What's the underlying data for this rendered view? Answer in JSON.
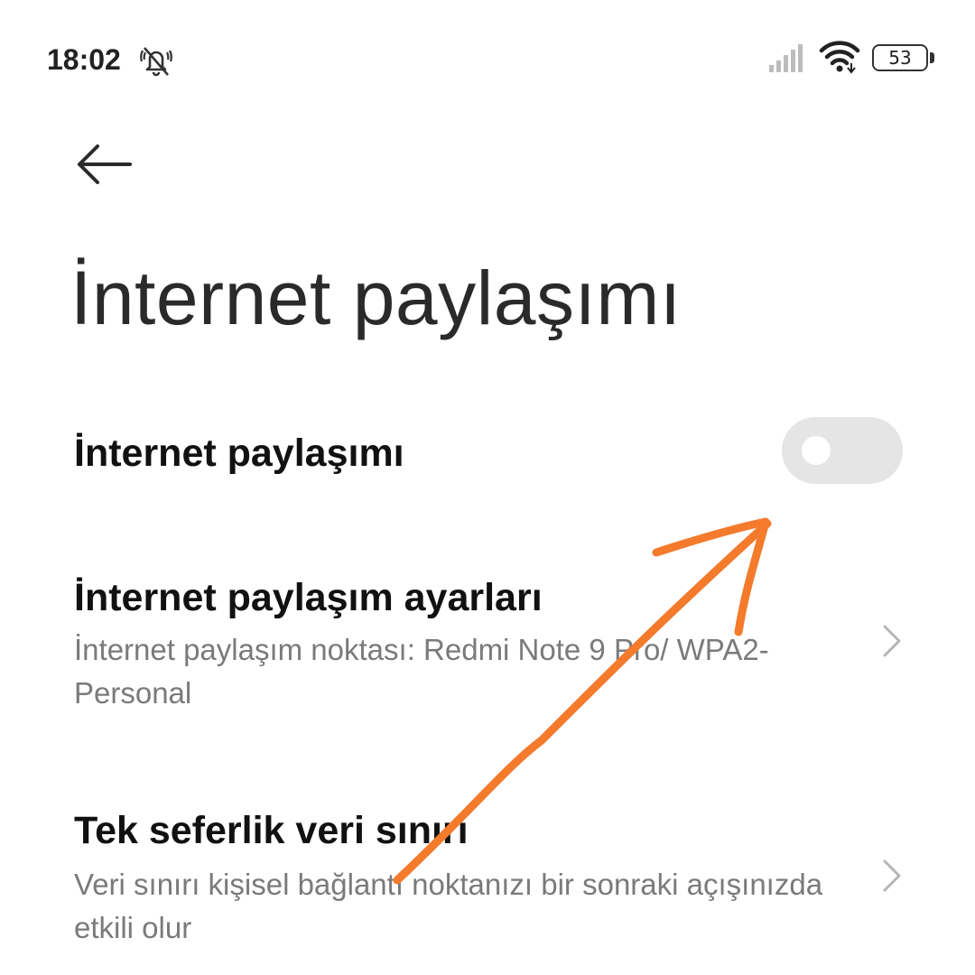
{
  "status_bar": {
    "time": "18:02",
    "battery_level": "53",
    "icons": [
      "dnd-muted-bell-icon",
      "signal-icon",
      "wifi-icon",
      "battery-icon"
    ]
  },
  "header": {
    "back_icon": "arrow-left-icon",
    "title": "İnternet paylaşımı"
  },
  "settings": {
    "items": [
      {
        "title": "İnternet paylaşımı",
        "control": "toggle",
        "enabled": false
      },
      {
        "title": "İnternet paylaşım ayarları",
        "subtitle": "İnternet paylaşım noktası: Redmi Note 9 Pro/ WPA2-Personal",
        "control": "chevron-right-icon"
      },
      {
        "title": "Tek seferlik veri sınırı",
        "subtitle": "Veri sınırı kişisel bağlantı noktanızı bir sonraki açışınızda etkili olur",
        "control": "chevron-right-icon"
      }
    ]
  },
  "colors": {
    "background": "#ffffff",
    "title_text": "#111111",
    "subtitle_text": "#7a7a7a",
    "toggle_off": "#e5e5e5",
    "annotation_arrow": "#f47a2c"
  }
}
